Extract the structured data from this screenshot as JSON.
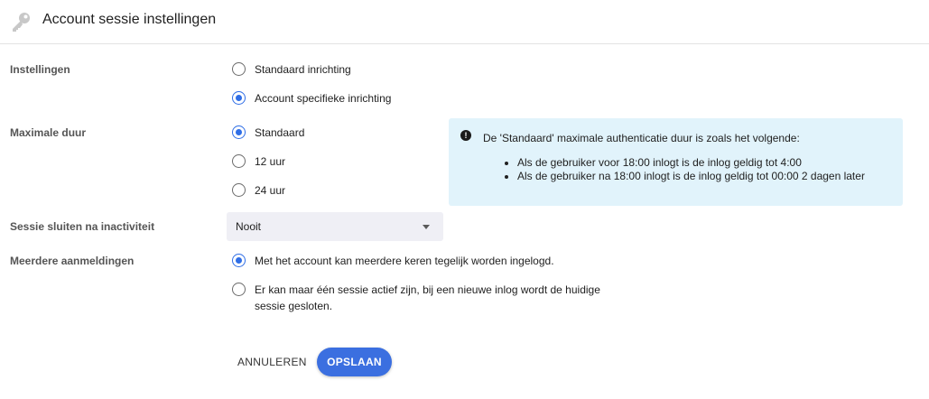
{
  "header": {
    "title": "Account sessie instellingen",
    "icon": "key-icon"
  },
  "settings": {
    "label": "Instellingen",
    "options": [
      {
        "label": "Standaard inrichting",
        "checked": false
      },
      {
        "label": "Account specifieke inrichting",
        "checked": true
      }
    ]
  },
  "max_duration": {
    "label": "Maximale duur",
    "options": [
      {
        "label": "Standaard",
        "checked": true
      },
      {
        "label": "12 uur",
        "checked": false
      },
      {
        "label": "24 uur",
        "checked": false
      }
    ],
    "info": {
      "icon": "exclamation-icon",
      "heading": "De 'Standaard' maximale authenticatie duur is zoals het volgende:",
      "items": [
        "Als de gebruiker voor 18:00 inlogt is de inlog geldig tot 4:00",
        "Als de gebruiker na 18:00 inlogt is de inlog geldig tot 00:00 2 dagen later"
      ]
    }
  },
  "inactivity": {
    "label": "Sessie sluiten na inactiviteit",
    "selected": "Nooit"
  },
  "multiple_logins": {
    "label": "Meerdere aanmeldingen",
    "options": [
      {
        "label": "Met het account kan meerdere keren tegelijk worden ingelogd.",
        "checked": true
      },
      {
        "label": "Er kan maar één sessie actief zijn, bij een nieuwe inlog wordt de huidige sessie gesloten.",
        "checked": false
      }
    ]
  },
  "actions": {
    "cancel_label": "ANNULEREN",
    "save_label": "OPSLAAN"
  },
  "colors": {
    "accent": "#3b6fe0",
    "info_background": "#e1f3fb",
    "select_background": "#efeff5"
  }
}
